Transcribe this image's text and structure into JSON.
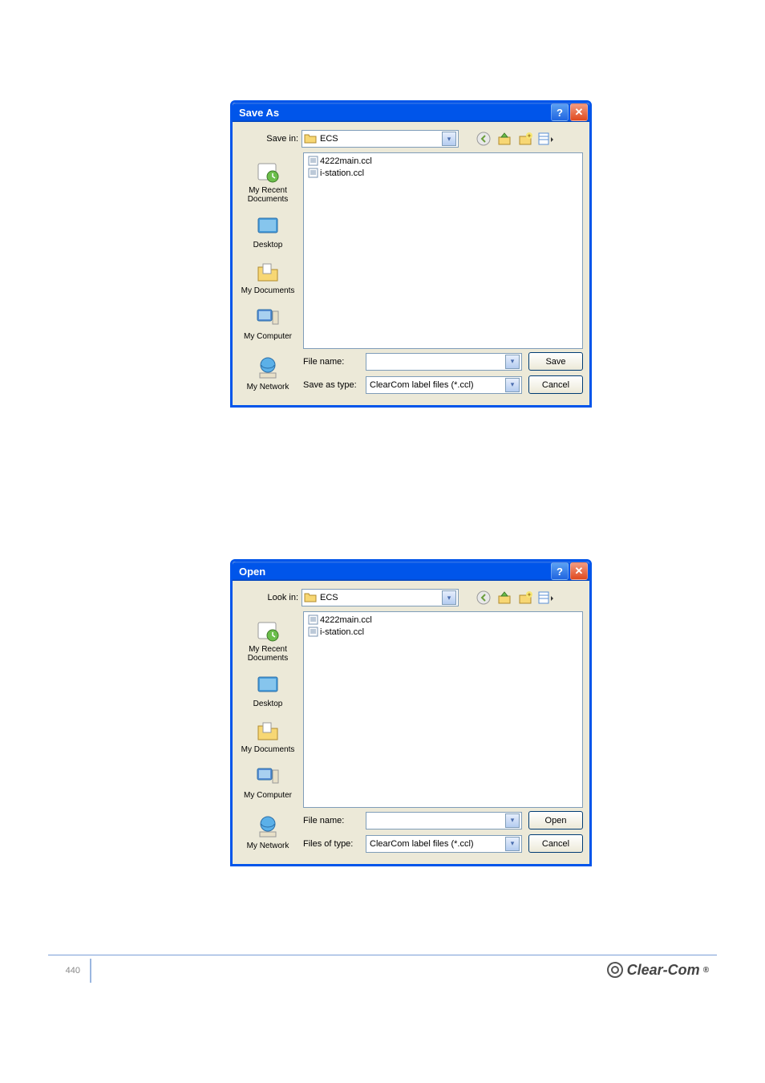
{
  "dialogs": [
    {
      "title": "Save As",
      "loc_label": "Save in:",
      "folder": "ECS",
      "files": [
        "4222main.ccl",
        "i-station.ccl"
      ],
      "places": [
        "My Recent Documents",
        "Desktop",
        "My Documents",
        "My Computer",
        "My Network"
      ],
      "filename_label": "File name:",
      "type_label": "Save as type:",
      "filename_value": "",
      "type_value": "ClearCom label files (*.ccl)",
      "primary_button": "Save",
      "cancel_button": "Cancel"
    },
    {
      "title": "Open",
      "loc_label": "Look in:",
      "folder": "ECS",
      "files": [
        "4222main.ccl",
        "i-station.ccl"
      ],
      "places": [
        "My Recent Documents",
        "Desktop",
        "My Documents",
        "My Computer",
        "My Network"
      ],
      "filename_label": "File name:",
      "type_label": "Files of type:",
      "filename_value": "",
      "type_value": "ClearCom label files (*.ccl)",
      "primary_button": "Open",
      "cancel_button": "Cancel"
    }
  ],
  "page_number": "440",
  "brand": "Clear-Com"
}
